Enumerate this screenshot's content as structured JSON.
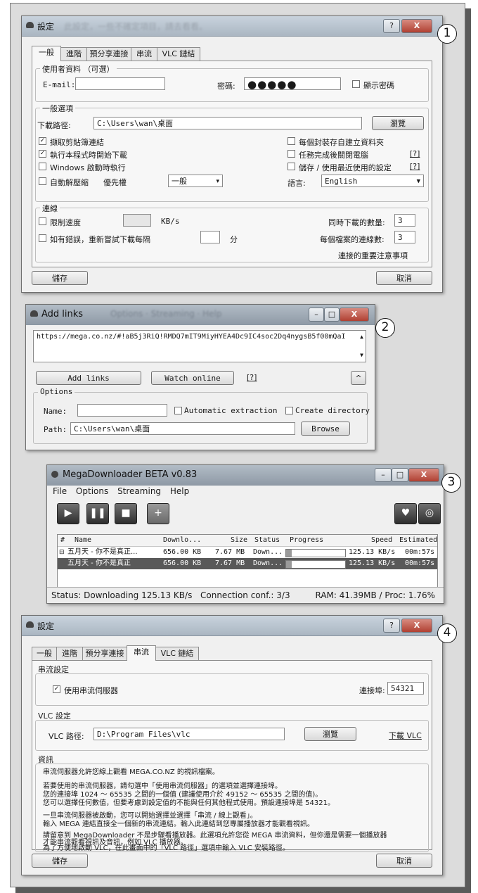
{
  "numbers": [
    "1",
    "2",
    "3",
    "4"
  ],
  "w1": {
    "title": "設定",
    "title_blur": "此設定，一些不確定項目，請去看看。",
    "help_btn": "?",
    "close_btn": "X",
    "tabs": [
      "一般",
      "進階",
      "預分享連接",
      "串流",
      "VLC 鏈結"
    ],
    "user_group": "使用者資料 （可選）",
    "email_label": "E-mail:",
    "email_value": "",
    "password_label": "密碼:",
    "password_mask": "●●●●●",
    "show_password": "顯示密碼",
    "general_group": "一般選項",
    "download_path_label": "下載路徑:",
    "download_path_value": "C:\\Users\\wan\\桌面",
    "browse": "瀏覽",
    "opt_clipboard": "擷取剪貼簿連結",
    "opt_autostart": "執行本程式時開始下載",
    "opt_windows_start": "Windows 啟動時執行",
    "opt_auto_extract": "自動解壓縮",
    "priority_label": "優先權",
    "priority_value": "一般",
    "opt_create_folder": "每個封裝存自建立資料夾",
    "opt_shutdown": "任務完成後關閉電腦",
    "opt_save_recent": "儲存 / 使用最近使用的設定",
    "help_link": "[?]",
    "language_label": "語言:",
    "language_value": "English",
    "conn_group": "連線",
    "limit_speed": "限制速度",
    "speed_unit": "KB/s",
    "retry_on_error": "如有錯誤，重新嘗試下載每隔",
    "retry_unit": "分",
    "concurrent_label": "同時下載的數量:",
    "concurrent_value": "3",
    "per_file_label": "每個檔案的連線數:",
    "per_file_value": "3",
    "reconnect_link": "連接的重要注意事項",
    "save": "儲存",
    "cancel": "取消"
  },
  "w2": {
    "title": "Add links",
    "title_blur": "Options · Streaming · Help",
    "url_text": "https://mega.co.nz/#!aB5j3RiQ!RMDQ7mIT9MiyHYEA4Dc9IC4soc2Dq4nygsB5f00mQaI",
    "add_links": "Add links",
    "watch_online": "Watch online",
    "help_link": "[?]",
    "collapse_btn": "^",
    "options_label": "Options",
    "name_label": "Name:",
    "name_value": "",
    "auto_extract": "Automatic extraction",
    "create_dir": "Create directory",
    "path_label": "Path:",
    "path_value": "C:\\Users\\wan\\桌面",
    "browse": "Browse"
  },
  "w3": {
    "title": "MegaDownloader BETA v0.83",
    "menu": [
      "File",
      "Options",
      "Streaming",
      "Help"
    ],
    "columns": [
      "#",
      "Name",
      "Downlo...",
      "Size",
      "Status",
      "Progress",
      "Speed",
      "Estimated"
    ],
    "rows": [
      {
        "name": "五月天 - 你不是真正...",
        "downloaded": "656.00 KB",
        "size": "7.67 MB",
        "status": "Down...",
        "progress": 0.09,
        "speed": "125.13 KB/s",
        "eta": "00m:57s"
      },
      {
        "name": "五月天 - 你不是真正",
        "downloaded": "656.00 KB",
        "size": "7.67 MB",
        "status": "Down...",
        "progress": 0.09,
        "speed": "125.13 KB/s",
        "eta": "00m:57s"
      }
    ],
    "status": "Status: Downloading 125.13 KB/s",
    "connection": "Connection conf.: 3/3",
    "ram": "RAM: 41.39MB / Proc: 1.76%"
  },
  "w4": {
    "title": "設定",
    "help_btn": "?",
    "close_btn": "X",
    "tabs": [
      "一般",
      "進階",
      "預分享連接",
      "串流",
      "VLC 鏈結"
    ],
    "stream_group": "串流設定",
    "use_stream_server": "使用串流伺服器",
    "port_label": "連接埠:",
    "port_value": "54321",
    "vlc_group": "VLC 設定",
    "vlc_path_label": "VLC 路徑:",
    "vlc_path_value": "D:\\Program Files\\vlc",
    "browse": "瀏覽",
    "download_vlc": "下載 VLC",
    "info_group": "資訊",
    "info_lines": [
      "串流伺服器允許您線上觀看 MEGA.CO.NZ 的視訊檔案。",
      "若要使用的串流伺服器，請勾選中「使用串流伺服器」的選項並選擇連接埠。",
      "您的連接埠 1024 ～ 65535 之間的一個值 (建議使用介於 49152 ～ 65535 之間的值)。",
      "您可以選擇任何數值，但要考慮到設定值的不能與任何其他程式使用。預設連接埠是 54321。",
      "一旦串流伺服器被啟動，您可以開始選擇並選擇「串流 / 線上觀看」。",
      "輸入 MEGA 連結直接全一個新的串流連結。輸入此連結到您專屬播放器才能觀看視訊。",
      "請留意到 MegaDownloader 不是步驟看播放器。此選項允許您從 MEGA 串流資料，但你還是需要一個播放器",
      "才能串流觀看視訊及音訊，例如 VLC 播放器。",
      "為了方便地啟動 VLC，在此畫面中的「VLC 路徑」選項中輸入 VLC 安裝路徑。"
    ],
    "save": "儲存",
    "cancel": "取消"
  }
}
